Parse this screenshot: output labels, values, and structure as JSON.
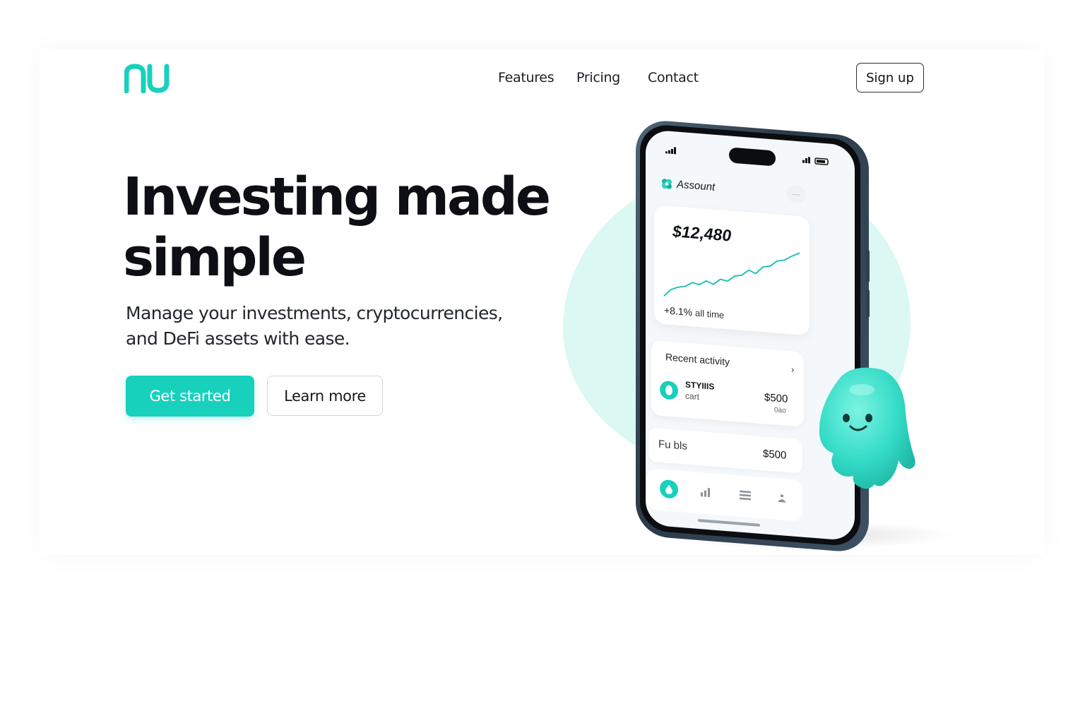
{
  "brand": {
    "logo_text": "nu",
    "accent": "#17d1bd"
  },
  "nav": {
    "links": [
      {
        "label": "Features"
      },
      {
        "label": "Pricing"
      },
      {
        "label": "Contact"
      }
    ],
    "signup_label": "Sign up"
  },
  "hero": {
    "title_line1": "Investing made",
    "title_line2": "simple",
    "subtitle_line1": "Manage your investments, cryptocurrencies,",
    "subtitle_line2": "and DeFi assets with ease.",
    "primary_cta": "Get started",
    "secondary_cta": "Learn more"
  },
  "phone": {
    "account_title": "Assount",
    "account_chip": "····",
    "balance": "$12,480",
    "change_value": "+8.1%",
    "change_label": "all time",
    "recent_title": "Recent activity",
    "activity": {
      "name": "STYIIIS",
      "sub": "cart",
      "amount": "$500",
      "amount_sub": "0ào"
    },
    "funds": {
      "label": "Fu bls",
      "amount": "$500"
    },
    "tabs": [
      "home-icon",
      "stats-icon",
      "list-icon",
      "profile-icon"
    ]
  }
}
